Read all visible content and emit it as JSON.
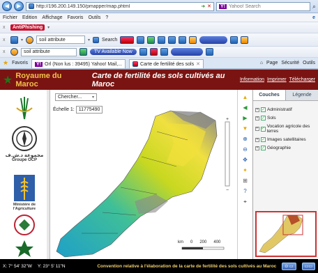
{
  "browser": {
    "address": "http://196.200.149.150/pmapper/map.phtml",
    "search_placeholder": "Yahoo! Search",
    "menu": [
      "Fichier",
      "Edition",
      "Affichage",
      "Favoris",
      "Outils",
      "?"
    ],
    "toolbar1": {
      "antiphishing": "AntiPhishing",
      "search_value": "soil attribute",
      "search_label": "Search"
    },
    "toolbar2": {
      "search_value": "soil attribute",
      "tv_label": "TV Available Now"
    },
    "favorites_label": "Favoris",
    "tabs": [
      "Orl (Non lus : 39495) Yahoo! Mail,...",
      "Carte de fertilité des sols"
    ],
    "cmd": {
      "page": "Page",
      "security": "Sécurité",
      "tools": "Outils"
    }
  },
  "app": {
    "title_left": "Royaume du Maroc",
    "title_main": "Carte de fertilité des sols cultivés au Maroc",
    "links": {
      "info": "Information",
      "print": "Imprimer",
      "download": "Télécharger"
    },
    "search_select": "Chercher...",
    "scale_label": "Échelle 1:",
    "scale_value": "11775490",
    "left_logos": {
      "ocp_name": "مجموعة د.ش.ف",
      "ocp_label": "Groupe OCP",
      "ministry": "Ministère de l'Agriculture"
    },
    "panel": {
      "tabs": [
        "Couches",
        "Légende"
      ],
      "layers": [
        "Administratif",
        "Sols",
        "Vocation agricole des terres",
        "Images satellitaires",
        "Géographie"
      ]
    },
    "scalebar": {
      "unit": "km",
      "ticks": [
        "0",
        "200",
        "400"
      ]
    }
  },
  "status": {
    "x": "X: 7° 54' 32\"W",
    "y": "Y: 23° 5' 11\"N",
    "convention": "Convention relative à l'élaboration de la carte de fertilité des sols cultivés au Maroc"
  },
  "colors": {
    "header_bg": "#7a1412",
    "title_gold": "#f3c24a",
    "status_bg": "#000000"
  }
}
